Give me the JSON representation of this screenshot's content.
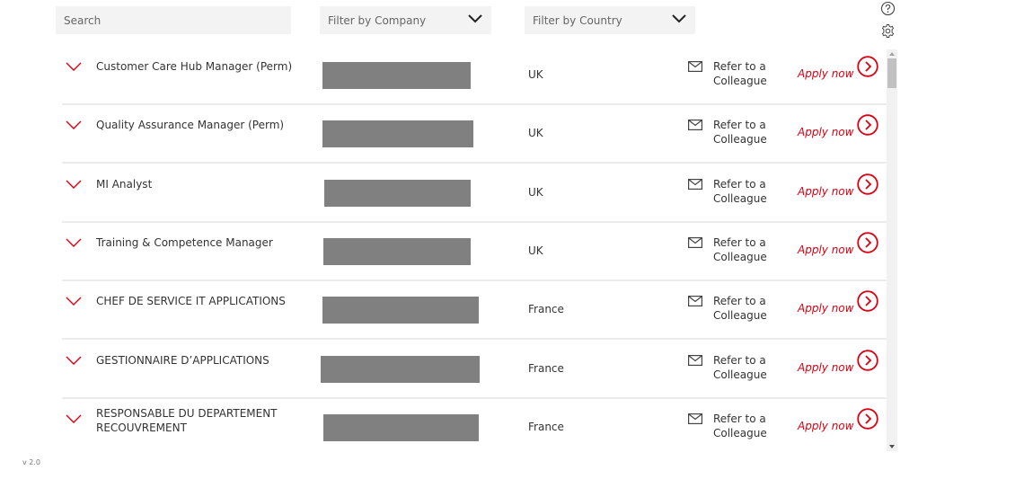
{
  "filters": {
    "search_placeholder": "Search",
    "company_label": "Filter by Company",
    "country_label": "Filter by Country"
  },
  "top_icons": [
    "help-icon",
    "settings-icon"
  ],
  "colors": {
    "accent": "#db0011",
    "filter_bg": "#f3f3f3",
    "redacted": "#808080",
    "divider": "#ebebeb"
  },
  "jobs": [
    {
      "title": "Customer Care Hub Manager (Perm)",
      "company": "",
      "country": "UK",
      "refer": [
        "Refer to a",
        "Colleague"
      ],
      "apply": "Apply now"
    },
    {
      "title": "Quality Assurance Manager (Perm)",
      "company": "",
      "country": "UK",
      "refer": [
        "Refer to a",
        "Colleague"
      ],
      "apply": "Apply now"
    },
    {
      "title": "MI Analyst",
      "company": "",
      "country": "UK",
      "refer": [
        "Refer to a",
        "Colleague"
      ],
      "apply": "Apply now"
    },
    {
      "title": "Training & Competence Manager",
      "company": "",
      "country": "UK",
      "refer": [
        "Refer to a",
        "Colleague"
      ],
      "apply": "Apply now"
    },
    {
      "title": "CHEF DE SERVICE IT APPLICATIONS",
      "company": "",
      "country": "France",
      "refer": [
        "Refer to a",
        "Colleague"
      ],
      "apply": "Apply now"
    },
    {
      "title": "GESTIONNAIRE D’APPLICATIONS",
      "company": "",
      "country": "France",
      "refer": [
        "Refer to a",
        "Colleague"
      ],
      "apply": "Apply now"
    },
    {
      "title": "RESPONSABLE DU DEPARTEMENT RECOUVREMENT",
      "company": "",
      "country": "France",
      "refer": [
        "Refer to a",
        "Colleague"
      ],
      "apply": "Apply now"
    }
  ],
  "version": "v 2.0"
}
